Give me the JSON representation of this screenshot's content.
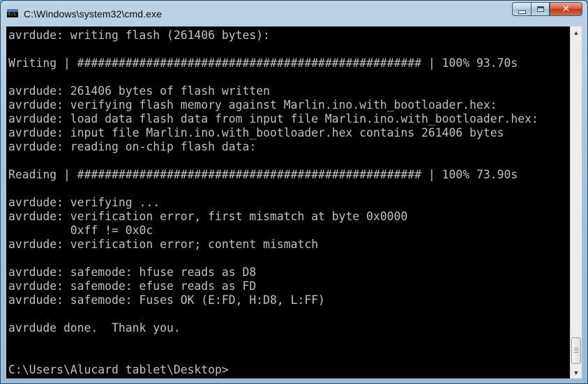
{
  "window": {
    "title": "C:\\Windows\\system32\\cmd.exe",
    "icon": "console-window-icon",
    "icon_text": "C:\\",
    "buttons": {
      "minimize": "minimize",
      "maximize": "maximize",
      "close": "close"
    }
  },
  "console": {
    "lines": [
      "avrdude: writing flash (261406 bytes):",
      "",
      "Writing | ################################################## | 100% 93.70s",
      "",
      "avrdude: 261406 bytes of flash written",
      "avrdude: verifying flash memory against Marlin.ino.with_bootloader.hex:",
      "avrdude: load data flash data from input file Marlin.ino.with_bootloader.hex:",
      "avrdude: input file Marlin.ino.with_bootloader.hex contains 261406 bytes",
      "avrdude: reading on-chip flash data:",
      "",
      "Reading | ################################################## | 100% 73.90s",
      "",
      "avrdude: verifying ...",
      "avrdude: verification error, first mismatch at byte 0x0000",
      "         0xff != 0x0c",
      "avrdude: verification error; content mismatch",
      "",
      "avrdude: safemode: hfuse reads as D8",
      "avrdude: safemode: efuse reads as FD",
      "avrdude: safemode: Fuses OK (E:FD, H:D8, L:FF)",
      "",
      "avrdude done.  Thank you.",
      "",
      "",
      "C:\\Users\\Alucard tablet\\Desktop>"
    ]
  },
  "colors": {
    "console_bg": "#000000",
    "console_fg": "#c0c0c0"
  }
}
